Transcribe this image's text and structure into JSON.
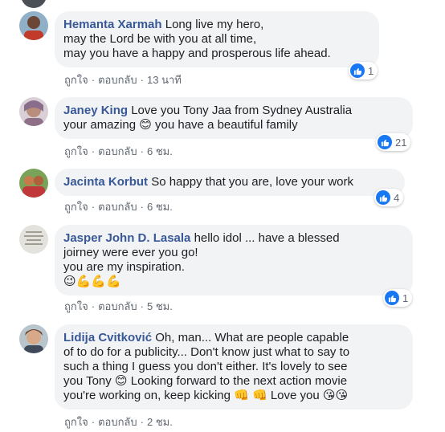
{
  "comments": [
    {
      "author": "Hemanta Xarmah",
      "lines": [
        "Long live my hero,",
        "may the Lord be with you at all time,",
        "may you have a happy and prosperous life ahead."
      ],
      "actions": {
        "like": "ถูกใจ",
        "reply": "ตอบกลับ",
        "time": "13 นาที"
      },
      "reaction_count": "1",
      "avatar_color": "#7a5a4a"
    },
    {
      "author": "Janey King",
      "lines": [
        "Love you Tony Jaa from Sydney Australia",
        "your amazing 😊 you have a beautiful family"
      ],
      "actions": {
        "like": "ถูกใจ",
        "reply": "ตอบกลับ",
        "time": "6 ชม."
      },
      "reaction_count": "21",
      "avatar_color": "#b89aa8"
    },
    {
      "author": "Jacinta Korbut",
      "lines": [
        "So happy that you are, love your work"
      ],
      "actions": {
        "like": "ถูกใจ",
        "reply": "ตอบกลับ",
        "time": "6 ชม."
      },
      "reaction_count": "4",
      "avatar_color": "#c0783c"
    },
    {
      "author": "Jasper John D. Lasala",
      "lines": [
        "hello idol ... have a blessed",
        "joirney were ever you go!",
        "you are my inspiration.",
        "😉💪💪💪"
      ],
      "actions": {
        "like": "ถูกใจ",
        "reply": "ตอบกลับ",
        "time": "5 ชม."
      },
      "reaction_count": "1",
      "avatar_color": "#d6d3c8"
    },
    {
      "author": "Lidija Cvitković",
      "lines": [
        "Oh, man... What are people capable",
        "of to do for a publicity... Don't know just what to say to",
        "such a thing I guess you don't either. It's lovely to see",
        "you Tony 😊 Looking forward to the next action movie",
        "you're working on, keep kicking 👊 👊 Love you 😘😘"
      ],
      "actions": {
        "like": "ถูกใจ",
        "reply": "ตอบกลับ",
        "time": "2 ชม."
      },
      "avatar_color": "#8a6a4a"
    }
  ],
  "colors": {
    "author": "#385898",
    "bubble": "#f2f3f5",
    "meta": "#606770",
    "like_blue": "#1877f2"
  },
  "icons": {
    "reaction": "like-thumb-icon"
  }
}
